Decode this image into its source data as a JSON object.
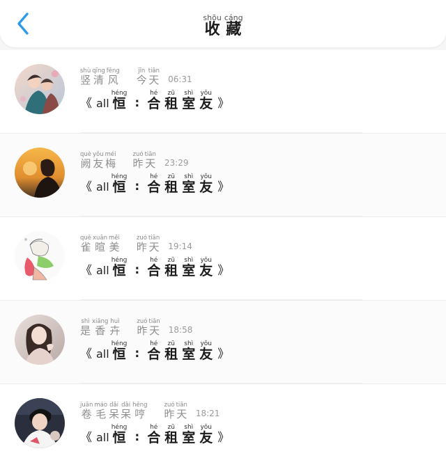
{
  "colors": {
    "accent": "#2f9be6",
    "background": "#f6f6f6",
    "header_bg": "#ffffff"
  },
  "header": {
    "back_icon": "chevron-left-icon",
    "title_chars": [
      {
        "py": "shōu",
        "hz": "收"
      },
      {
        "py": "cáng",
        "hz": "藏"
      }
    ]
  },
  "items": [
    {
      "avatar": "anime-couple-avatar",
      "name_chars": [
        {
          "py": "shù",
          "hz": "竖"
        },
        {
          "py": "qīng",
          "hz": "清"
        },
        {
          "py": "fēng",
          "hz": "风"
        }
      ],
      "day_chars": [
        {
          "py": "jīn",
          "hz": "今"
        },
        {
          "py": "tiān",
          "hz": "天"
        }
      ],
      "time": "06:31",
      "title": {
        "open": "《",
        "latin": "all",
        "first": {
          "py": "héng",
          "hz": "恒"
        },
        "colon": ":",
        "rest": [
          {
            "py": "hé",
            "hz": "合"
          },
          {
            "py": "zū",
            "hz": "租"
          },
          {
            "py": "shì",
            "hz": "室"
          },
          {
            "py": "yǒu",
            "hz": "友"
          }
        ],
        "close": "》"
      }
    },
    {
      "avatar": "sunset-silhouette-avatar",
      "name_chars": [
        {
          "py": "què",
          "hz": "阙"
        },
        {
          "py": "yǒu",
          "hz": "友"
        },
        {
          "py": "méi",
          "hz": "梅"
        }
      ],
      "day_chars": [
        {
          "py": "zuó",
          "hz": "昨"
        },
        {
          "py": "tiān",
          "hz": "天"
        }
      ],
      "time": "23:29",
      "title": {
        "open": "《",
        "latin": "all",
        "first": {
          "py": "héng",
          "hz": "恒"
        },
        "colon": ":",
        "rest": [
          {
            "py": "hé",
            "hz": "合"
          },
          {
            "py": "zū",
            "hz": "租"
          },
          {
            "py": "shì",
            "hz": "室"
          },
          {
            "py": "yǒu",
            "hz": "友"
          }
        ],
        "close": "》"
      }
    },
    {
      "avatar": "sketch-character-avatar",
      "name_chars": [
        {
          "py": "què",
          "hz": "雀"
        },
        {
          "py": "xuān",
          "hz": "暄"
        },
        {
          "py": "měi",
          "hz": "美"
        }
      ],
      "day_chars": [
        {
          "py": "zuó",
          "hz": "昨"
        },
        {
          "py": "tiān",
          "hz": "天"
        }
      ],
      "time": "19:14",
      "title": {
        "open": "《",
        "latin": "all",
        "first": {
          "py": "héng",
          "hz": "恒"
        },
        "colon": ":",
        "rest": [
          {
            "py": "hé",
            "hz": "合"
          },
          {
            "py": "zū",
            "hz": "租"
          },
          {
            "py": "shì",
            "hz": "室"
          },
          {
            "py": "yǒu",
            "hz": "友"
          }
        ],
        "close": "》"
      }
    },
    {
      "avatar": "girl-portrait-avatar",
      "name_chars": [
        {
          "py": "shì",
          "hz": "是"
        },
        {
          "py": "xiāng",
          "hz": "香"
        },
        {
          "py": "huì",
          "hz": "卉"
        }
      ],
      "day_chars": [
        {
          "py": "zuó",
          "hz": "昨"
        },
        {
          "py": "tiān",
          "hz": "天"
        }
      ],
      "time": "18:58",
      "title": {
        "open": "《",
        "latin": "all",
        "first": {
          "py": "héng",
          "hz": "恒"
        },
        "colon": ":",
        "rest": [
          {
            "py": "hé",
            "hz": "合"
          },
          {
            "py": "zū",
            "hz": "租"
          },
          {
            "py": "shì",
            "hz": "室"
          },
          {
            "py": "yǒu",
            "hz": "友"
          }
        ],
        "close": "》"
      }
    },
    {
      "avatar": "boy-portrait-avatar",
      "name_chars": [
        {
          "py": "juǎn",
          "hz": "卷"
        },
        {
          "py": "máo",
          "hz": "毛"
        },
        {
          "py": "dāi",
          "hz": "呆"
        },
        {
          "py": "dāi",
          "hz": "呆"
        },
        {
          "py": "hēng",
          "hz": "哼"
        }
      ],
      "day_chars": [
        {
          "py": "zuó",
          "hz": "昨"
        },
        {
          "py": "tiān",
          "hz": "天"
        }
      ],
      "time": "18:21",
      "title": {
        "open": "《",
        "latin": "all",
        "first": {
          "py": "héng",
          "hz": "恒"
        },
        "colon": ":",
        "rest": [
          {
            "py": "hé",
            "hz": "合"
          },
          {
            "py": "zū",
            "hz": "租"
          },
          {
            "py": "shì",
            "hz": "室"
          },
          {
            "py": "yǒu",
            "hz": "友"
          }
        ],
        "close": "》"
      }
    }
  ]
}
